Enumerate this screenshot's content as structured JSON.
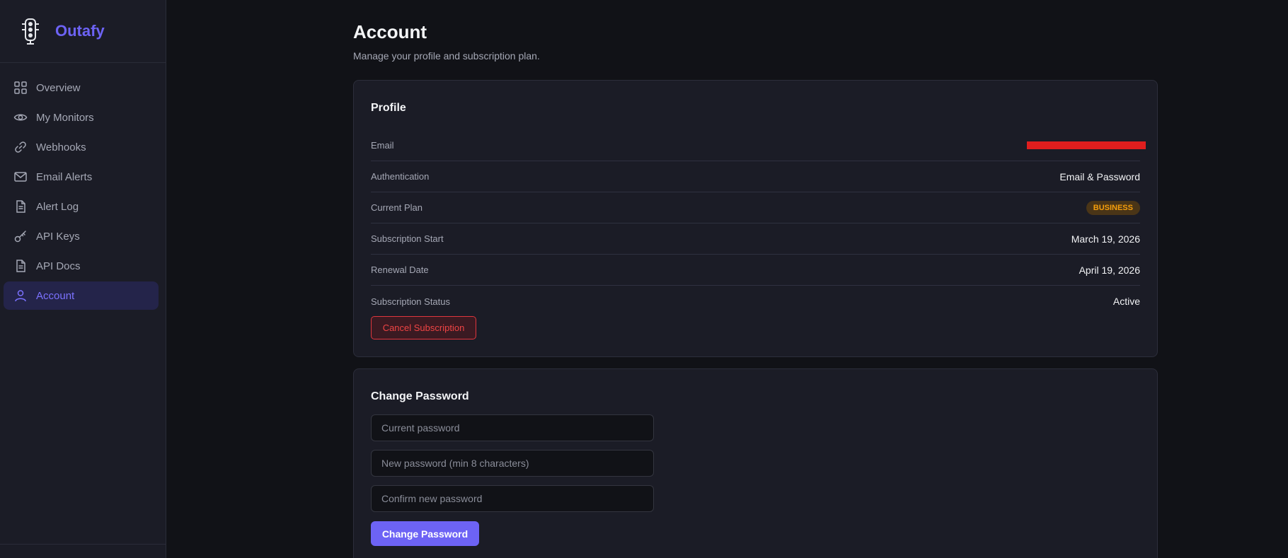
{
  "brand": {
    "name": "Outafy"
  },
  "sidebar": {
    "items": [
      {
        "label": "Overview",
        "icon": "grid-icon",
        "active": false
      },
      {
        "label": "My Monitors",
        "icon": "eye-icon",
        "active": false
      },
      {
        "label": "Webhooks",
        "icon": "link-icon",
        "active": false
      },
      {
        "label": "Email Alerts",
        "icon": "mail-icon",
        "active": false
      },
      {
        "label": "Alert Log",
        "icon": "document-icon",
        "active": false
      },
      {
        "label": "API Keys",
        "icon": "key-icon",
        "active": false
      },
      {
        "label": "API Docs",
        "icon": "document-icon",
        "active": false
      },
      {
        "label": "Account",
        "icon": "user-icon",
        "active": true
      }
    ]
  },
  "page": {
    "title": "Account",
    "subtitle": "Manage your profile and subscription plan."
  },
  "profile": {
    "title": "Profile",
    "rows": {
      "email_label": "Email",
      "auth_label": "Authentication",
      "auth_value": "Email & Password",
      "plan_label": "Current Plan",
      "plan_value": "BUSINESS",
      "start_label": "Subscription Start",
      "start_value": "March 19, 2026",
      "renewal_label": "Renewal Date",
      "renewal_value": "April 19, 2026",
      "status_label": "Subscription Status",
      "status_value": "Active"
    },
    "cancel_label": "Cancel Subscription"
  },
  "password": {
    "title": "Change Password",
    "current_placeholder": "Current password",
    "new_placeholder": "New password (min 8 characters)",
    "confirm_placeholder": "Confirm new password",
    "submit_label": "Change Password"
  },
  "colors": {
    "accent": "#6d63f5",
    "danger": "#ef4444",
    "badge_text": "#f59e0b",
    "redaction": "#e01e1e"
  }
}
